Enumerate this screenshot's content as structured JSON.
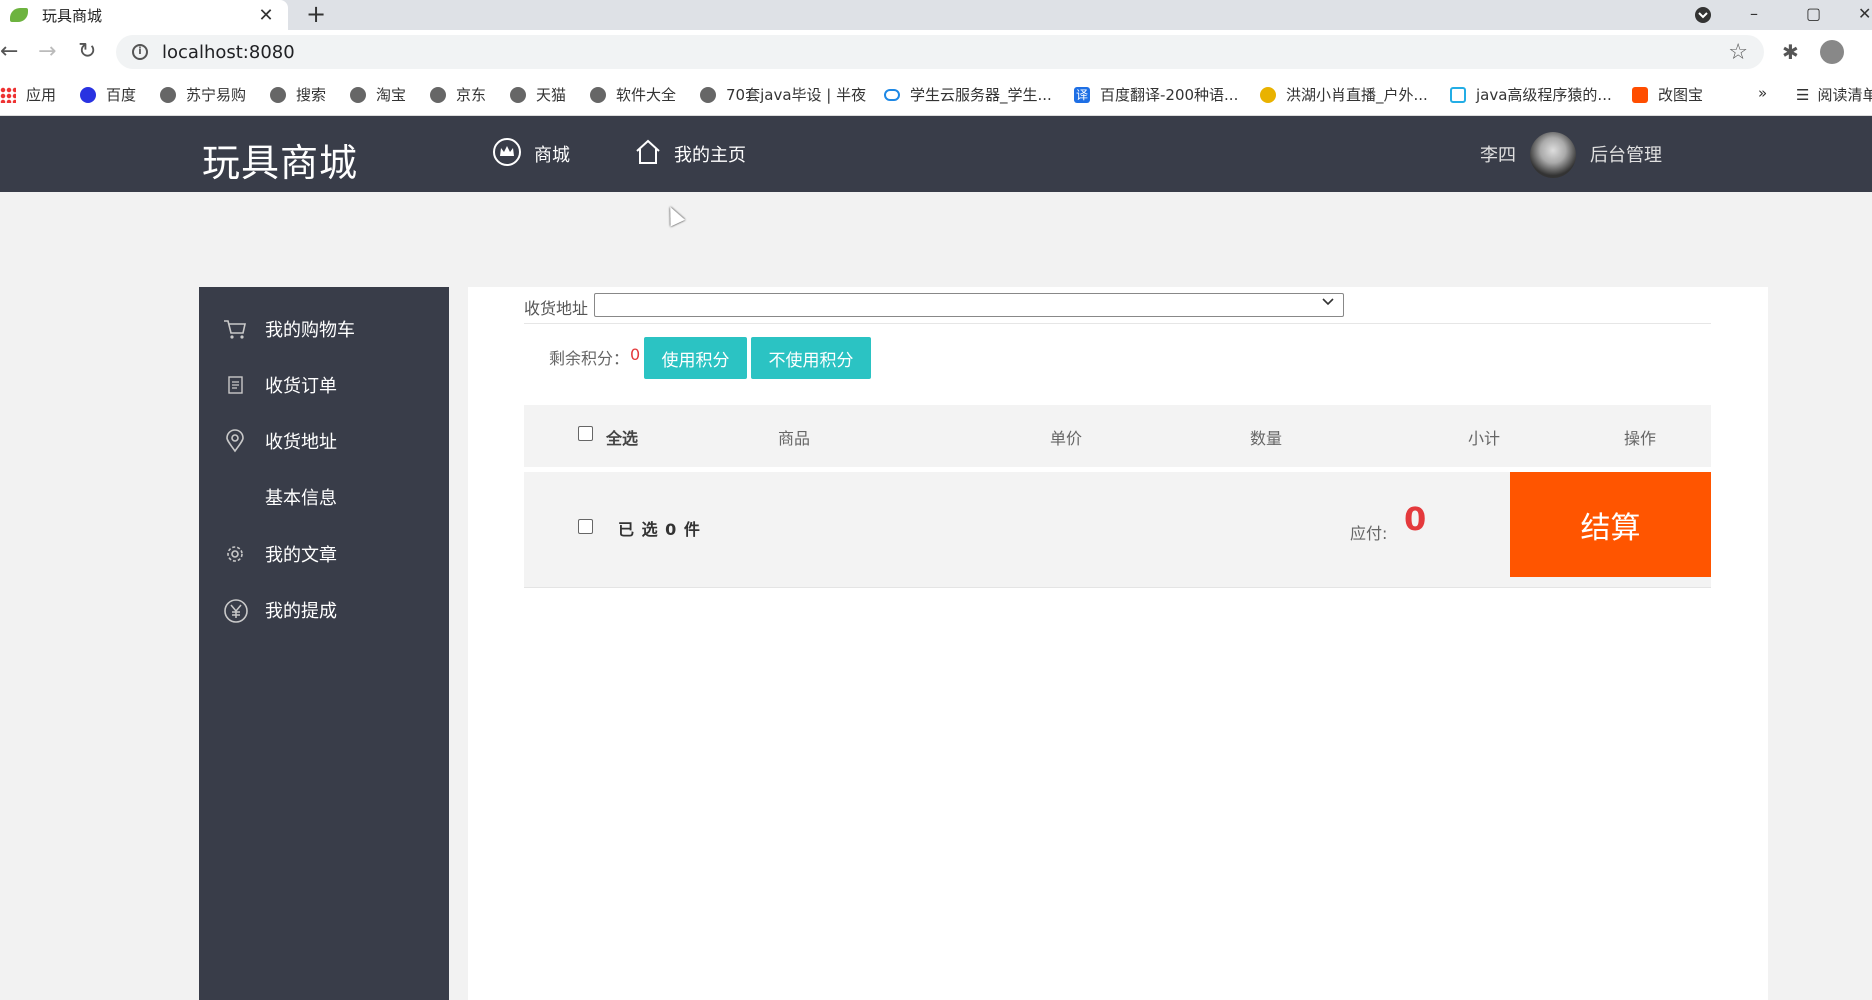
{
  "browser": {
    "tab_title": "玩具商城",
    "tab_close": "✕",
    "new_tab": "+",
    "url": "localhost:8080",
    "window_controls": [
      "–",
      "▢",
      "✕"
    ],
    "bookmarks": [
      "应用",
      "百度",
      "苏宁易购",
      "搜索",
      "淘宝",
      "京东",
      "天猫",
      "软件大全",
      "70套java毕设 | 半夜",
      "学生云服务器_学生...",
      "百度翻译-200种语...",
      "洪湖小肖直播_户外...",
      "java高级程序猿的...",
      "改图宝"
    ],
    "bookmarks_more": "»",
    "reading_list": "阅读清单"
  },
  "header": {
    "logo": "玩具商城",
    "nav": [
      {
        "label": "商城",
        "icon": "crown-icon"
      },
      {
        "label": "我的主页",
        "icon": "home-icon"
      }
    ],
    "user_name": "李四",
    "admin_link": "后台管理"
  },
  "sidebar": {
    "items": [
      {
        "label": "我的购物车",
        "icon": "cart-icon"
      },
      {
        "label": "收货订单",
        "icon": "document-icon"
      },
      {
        "label": "收货地址",
        "icon": "location-pin-icon"
      },
      {
        "label": "基本信息",
        "icon": ""
      },
      {
        "label": "我的文章",
        "icon": "gear-icon"
      },
      {
        "label": "我的提成",
        "icon": "yen-icon"
      }
    ]
  },
  "cart": {
    "address_label": "收货地址",
    "address_value": "",
    "points_label": "剩余积分：",
    "points_value": "0",
    "use_points_button": "使用积分",
    "no_points_button": "不使用积分",
    "columns": [
      "全选",
      "商品",
      "单价",
      "数量",
      "小计",
      "操作"
    ],
    "selected_text": "已 选 0 件",
    "pay_label": "应付:",
    "pay_value": "0",
    "checkout_button": "结算"
  },
  "colors": {
    "header_bg": "#393d49",
    "button_teal": "#2bc3c3",
    "checkout_orange": "#ff5500",
    "price_red": "#e4393c"
  }
}
